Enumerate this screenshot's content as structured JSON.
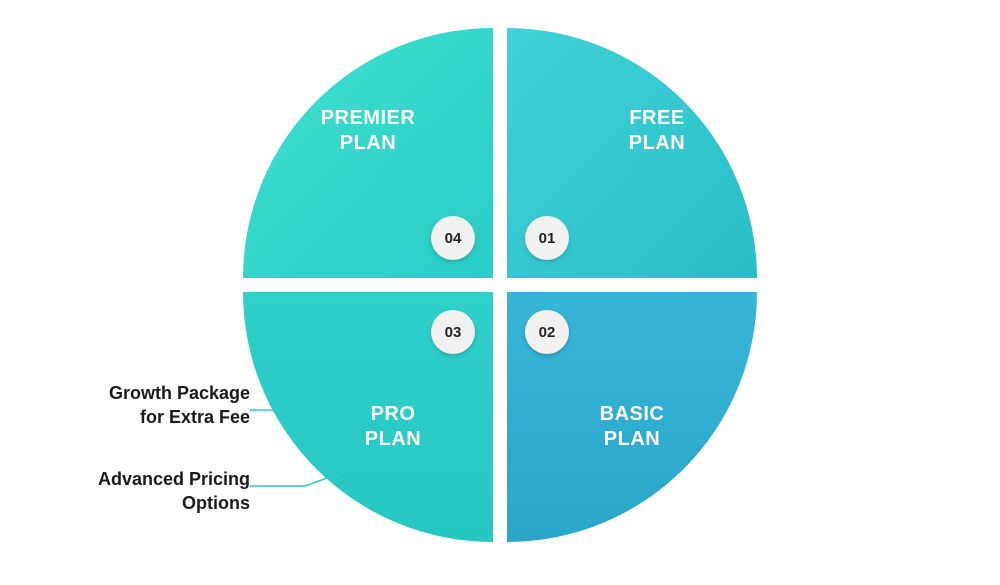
{
  "quadrants": {
    "top_right": {
      "title": "FREE\nPLAN",
      "number": "01"
    },
    "bottom_right": {
      "title": "BASIC\nPLAN",
      "number": "02"
    },
    "bottom_left": {
      "title": "PRO\nPLAN",
      "number": "03"
    },
    "top_left": {
      "title": "PREMIER\nPLAN",
      "number": "04"
    }
  },
  "annotations": {
    "a1": "Growth Package\nfor Extra Fee",
    "a2": "Advanced Pricing\nOptions"
  },
  "colors": {
    "top_right": "#2abec8",
    "top_left": "#2acdc7",
    "bottom_left": "#26c6c3",
    "bottom_right": "#2aa6ca",
    "badge_bg": "#f1f1f1"
  }
}
